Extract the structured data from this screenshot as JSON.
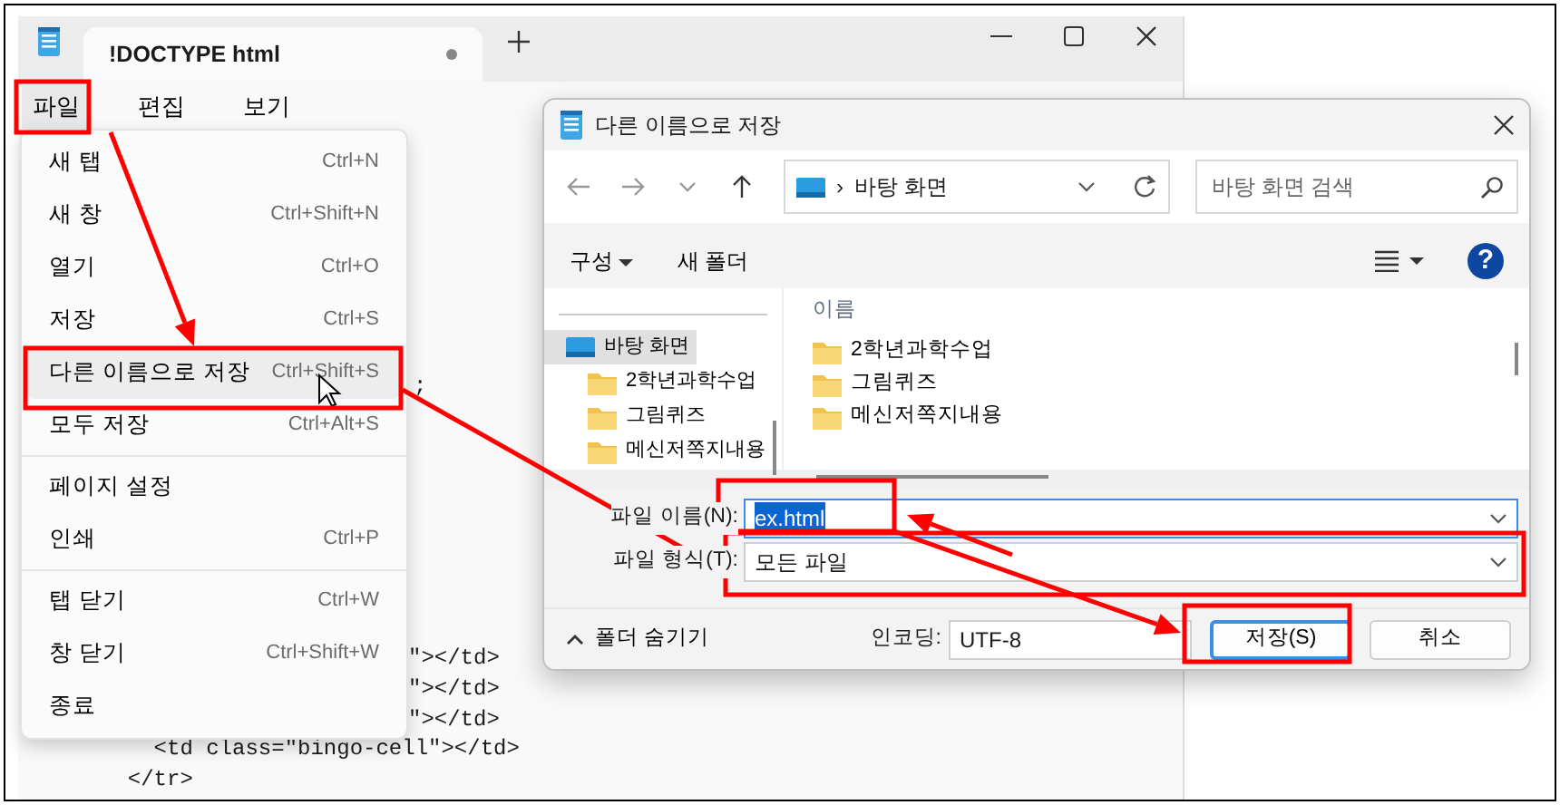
{
  "editor": {
    "tab": {
      "title": "!DOCTYPE html",
      "modified": true
    },
    "menu_bar": [
      {
        "label": "파일",
        "selected": true
      },
      {
        "label": "편집",
        "selected": false
      },
      {
        "label": "보기",
        "selected": false
      }
    ],
    "code_top": [
      {
        "text": ";"
      }
    ],
    "code_bottom": [
      {
        "text": "\"></td>",
        "kind": "covered"
      },
      {
        "text": "\"></td>",
        "kind": "covered"
      },
      {
        "text": "\"></td>",
        "kind": "covered"
      },
      {
        "text": "    <td class=\"bingo-cell\"></td>",
        "kind": "plain"
      },
      {
        "text": "  </tr>",
        "kind": "plain"
      }
    ]
  },
  "file_menu": {
    "items": [
      {
        "label": "새 탭",
        "shortcut": "Ctrl+N",
        "highlighted": false,
        "separator_after": false
      },
      {
        "label": "새 창",
        "shortcut": "Ctrl+Shift+N",
        "highlighted": false,
        "separator_after": false
      },
      {
        "label": "열기",
        "shortcut": "Ctrl+O",
        "highlighted": false,
        "separator_after": false
      },
      {
        "label": "저장",
        "shortcut": "Ctrl+S",
        "highlighted": false,
        "separator_after": false
      },
      {
        "label": "다른 이름으로 저장",
        "shortcut": "Ctrl+Shift+S",
        "highlighted": true,
        "separator_after": false
      },
      {
        "label": "모두 저장",
        "shortcut": "Ctrl+Alt+S",
        "highlighted": false,
        "separator_after": true
      },
      {
        "label": "페이지 설정",
        "highlighted": false,
        "separator_after": false
      },
      {
        "label": "인쇄",
        "shortcut": "Ctrl+P",
        "highlighted": false,
        "separator_after": true
      },
      {
        "label": "탭 닫기",
        "shortcut": "Ctrl+W",
        "highlighted": false,
        "separator_after": false
      },
      {
        "label": "창 닫기",
        "shortcut": "Ctrl+Shift+W",
        "highlighted": false,
        "separator_after": false
      },
      {
        "label": "종료",
        "highlighted": false,
        "separator_after": false
      }
    ]
  },
  "dialog": {
    "title": "다른 이름으로 저장",
    "address": {
      "separator": "›",
      "location": "바탕 화면"
    },
    "search": {
      "placeholder": "바탕 화면 검색"
    },
    "toolbar": {
      "organize": "구성",
      "new_folder": "새 폴더",
      "help": "?"
    },
    "nav_pane": [
      {
        "label": "바탕 화면",
        "kind": "desktop",
        "selected": true
      },
      {
        "label": "2학년과학수업",
        "kind": "folder",
        "selected": false
      },
      {
        "label": "그림퀴즈",
        "kind": "folder",
        "selected": false
      },
      {
        "label": "메신저쪽지내용",
        "kind": "folder",
        "selected": false
      }
    ],
    "file_list": {
      "column": "이름",
      "items": [
        {
          "label": "2학년과학수업"
        },
        {
          "label": "그림퀴즈"
        },
        {
          "label": "메신저쪽지내용"
        }
      ]
    },
    "filename": {
      "label": "파일 이름(N):",
      "value": "ex.html",
      "value_selected": true
    },
    "filetype": {
      "label": "파일 형식(T):",
      "value": "모든 파일"
    },
    "hide_folders": "폴더 숨기기",
    "encoding": {
      "label": "인코딩:",
      "value": "UTF-8"
    },
    "buttons": [
      {
        "label": "저장(S)",
        "default": true
      },
      {
        "label": "취소",
        "default": false
      }
    ]
  }
}
